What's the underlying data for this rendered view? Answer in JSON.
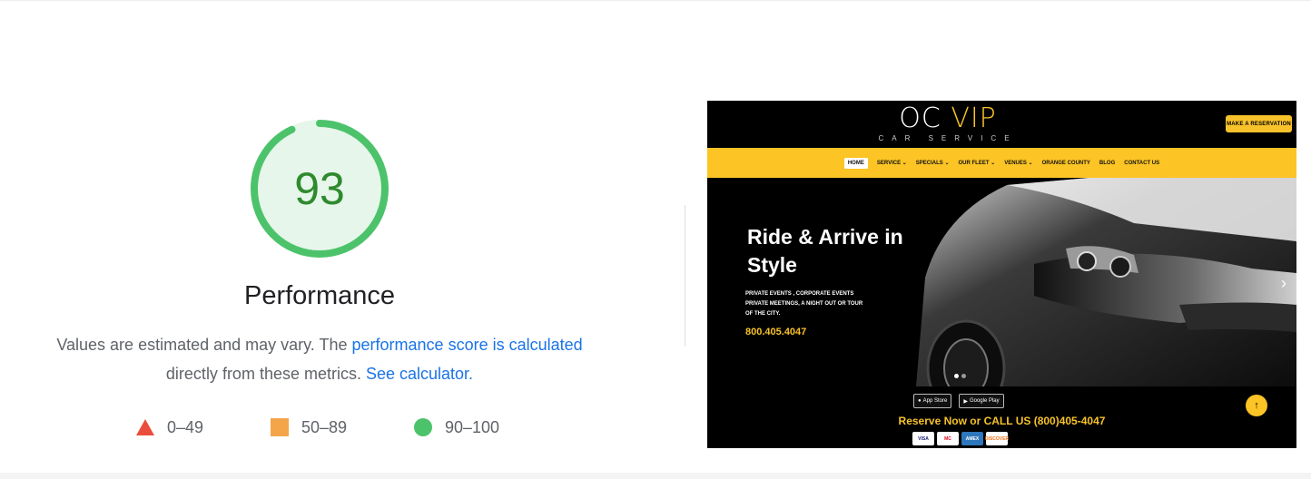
{
  "score": {
    "value": "93",
    "fraction": 0.93,
    "title": "Performance",
    "color_ring": "#4cc36b",
    "color_text": "#2f8a2d"
  },
  "description": {
    "prefix": "Values are estimated and may vary. The ",
    "link1": "performance score is calculated",
    "middle": "directly from these metrics. ",
    "link2": "See calculator."
  },
  "legend": [
    {
      "icon": "triangle-icon",
      "label": "0–49",
      "color": "#eb4d3d"
    },
    {
      "icon": "square-icon",
      "label": "50–89",
      "color": "#f4a54a"
    },
    {
      "icon": "circle-icon",
      "label": "90–100",
      "color": "#4cc36b"
    }
  ],
  "screenshot": {
    "logo_main": "OC",
    "logo_vip": "VIP",
    "logo_sub": "CAR SERVICE",
    "reserve_button": "MAKE A RESERVATION",
    "nav": [
      "HOME",
      "SERVICE ⌄",
      "SPECIALS ⌄",
      "OUR FLEET ⌄",
      "VENUES ⌄",
      "ORANGE COUNTY",
      "BLOG",
      "CONTACT US"
    ],
    "hero_title": "Ride & Arrive in Style",
    "hero_desc_1": "PRIVATE EVENTS , CORPORATE EVENTS",
    "hero_desc_2": "PRIVATE MEETINGS, A NIGHT OUT OR TOUR",
    "hero_desc_3": "OF THE CITY.",
    "hero_phone": "800.405.4047",
    "app_store": "App Store",
    "google_play": "Google Play",
    "call_line": "Reserve Now or CALL US (800)405-4047",
    "cards": [
      "VISA",
      "MC",
      "AMEX",
      "DISCOVER"
    ],
    "accent": "#fcc424"
  }
}
